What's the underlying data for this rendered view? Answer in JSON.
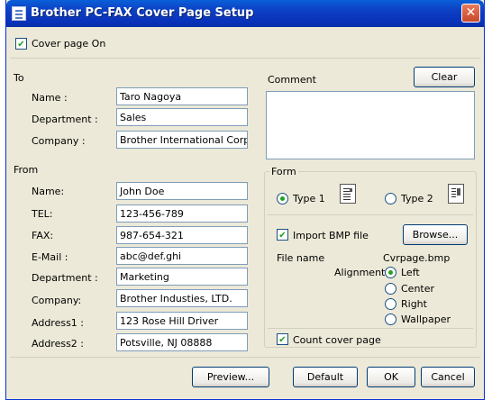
{
  "window": {
    "title": "Brother PC-FAX Cover Page Setup",
    "close_glyph": "✕"
  },
  "cover_page_on": {
    "label": "Cover page On",
    "checked": true
  },
  "to": {
    "heading": "To",
    "name_label": "Name :",
    "name_value": "Taro Nagoya",
    "department_label": "Department :",
    "department_value": "Sales",
    "company_label": "Company :",
    "company_value": "Brother International Corp"
  },
  "from": {
    "heading": "From",
    "name_label": "Name:",
    "name_value": "John Doe",
    "tel_label": "TEL:",
    "tel_value": "123-456-789",
    "fax_label": "FAX:",
    "fax_value": "987-654-321",
    "email_label": "E-Mail :",
    "email_value": "abc@def.ghi",
    "department_label": "Department :",
    "department_value": "Marketing",
    "company_label": "Company:",
    "company_value": "Brother Industies, LTD.",
    "address1_label": "Address1 :",
    "address1_value": "123 Rose Hill Driver",
    "address2_label": "Address2 :",
    "address2_value": "Potsville, NJ 08888"
  },
  "comment": {
    "label": "Comment",
    "clear_label": "Clear",
    "value": ""
  },
  "form": {
    "heading": "Form",
    "type1_label": "Type 1",
    "type1_selected": true,
    "type2_label": "Type 2",
    "type2_selected": false,
    "icons": [
      "type1-layout-icon",
      "type2-layout-icon"
    ]
  },
  "import_bmp": {
    "label": "Import BMP file",
    "checked": true,
    "browse_label": "Browse...",
    "file_name_label": "File name",
    "file_name_value": "Cvrpage.bmp",
    "alignment_label": "Alignment",
    "alignment_options": [
      "Left",
      "Center",
      "Right",
      "Wallpaper"
    ],
    "alignment_selected": "Left"
  },
  "count_cover_page": {
    "label": "Count cover page",
    "checked": true
  },
  "buttons": {
    "preview": "Preview...",
    "default": "Default",
    "ok": "OK",
    "cancel": "Cancel"
  },
  "colors": {
    "titlebar": "#0a5fd8",
    "dialog_bg": "#ece9d8",
    "accent_check": "#21a121"
  }
}
